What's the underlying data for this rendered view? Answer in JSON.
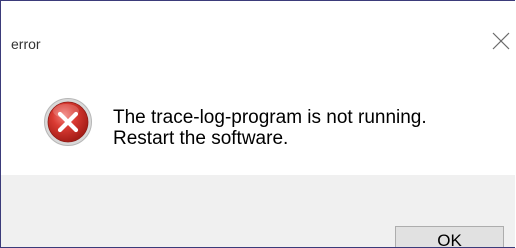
{
  "dialog": {
    "title": "error",
    "message_lines": [
      "The trace-log-program is not running.",
      "Restart the software."
    ],
    "ok_label": "OK",
    "icons": {
      "close": "close-icon",
      "status": "error-icon"
    },
    "colors": {
      "error_red": "#c62828",
      "footer_bg": "#f0f0f0",
      "button_bg": "#e1e1e1",
      "border": "#3b3b7a"
    }
  }
}
